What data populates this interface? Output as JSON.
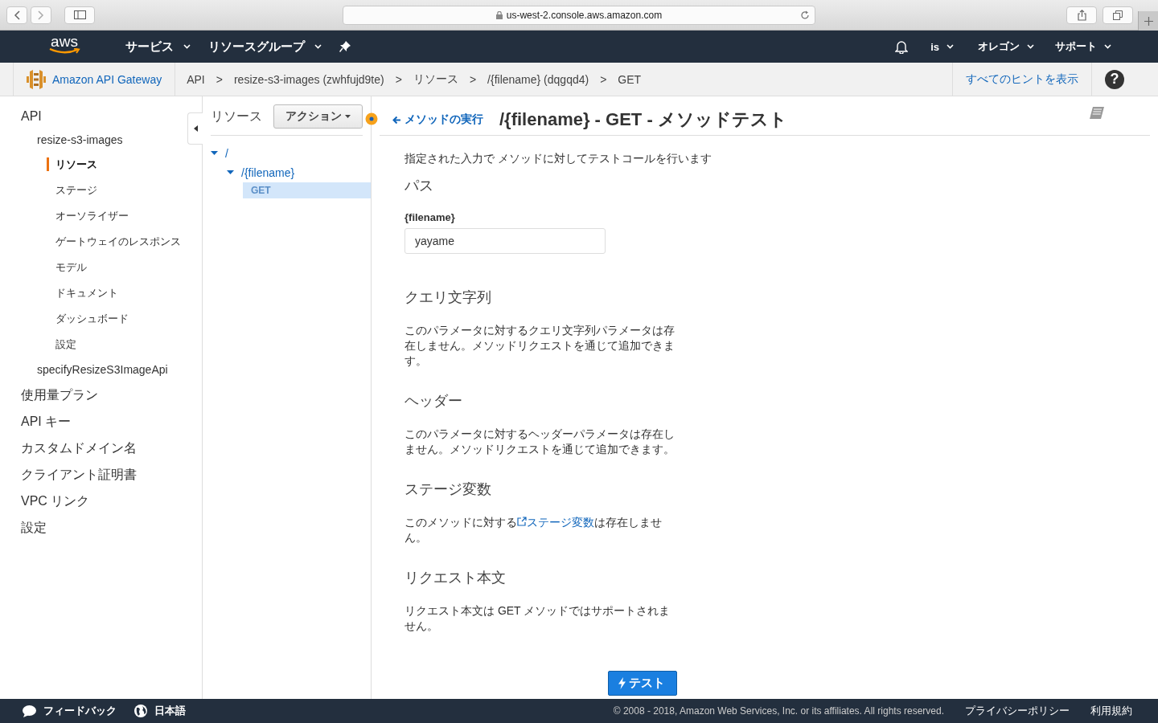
{
  "browser": {
    "url": "us-west-2.console.aws.amazon.com"
  },
  "top_nav": {
    "logo": "aws",
    "menus": [
      {
        "label": "サービス"
      },
      {
        "label": "リソースグループ"
      }
    ],
    "account": "is",
    "region": "オレゴン",
    "support": "サポート"
  },
  "breadcrumb": {
    "service": "Amazon API Gateway",
    "separator": ">",
    "items": [
      "API",
      "resize-s3-images (zwhfujd9te)",
      "リソース",
      "/{filename} (dqgqd4)",
      "GET"
    ],
    "hints_link": "すべてのヒントを表示",
    "help": "?"
  },
  "sidebar": {
    "items": [
      {
        "label": "API",
        "selected": false,
        "children": [
          {
            "label": "resize-s3-images",
            "selected": false,
            "children": [
              {
                "label": "リソース",
                "selected": true
              },
              {
                "label": "ステージ",
                "selected": false
              },
              {
                "label": "オーソライザー",
                "selected": false
              },
              {
                "label": "ゲートウェイのレスポンス",
                "selected": false
              },
              {
                "label": "モデル",
                "selected": false
              },
              {
                "label": "ドキュメント",
                "selected": false
              },
              {
                "label": "ダッシュボード",
                "selected": false
              },
              {
                "label": "設定",
                "selected": false
              }
            ]
          },
          {
            "label": "specifyResizeS3ImageApi",
            "selected": false
          }
        ]
      },
      {
        "label": "使用量プラン",
        "selected": false
      },
      {
        "label": "API キー",
        "selected": false
      },
      {
        "label": "カスタムドメイン名",
        "selected": false
      },
      {
        "label": "クライアント証明書",
        "selected": false
      },
      {
        "label": "VPC リンク",
        "selected": false
      },
      {
        "label": "設定",
        "selected": false
      }
    ]
  },
  "resources": {
    "title": "リソース",
    "actions_button": "アクション",
    "tree": [
      {
        "label": "/",
        "expanded": true,
        "selected": false,
        "children": [
          {
            "label": "/{filename}",
            "expanded": true,
            "selected": false,
            "children": [
              {
                "label": "GET",
                "selected": true
              }
            ]
          }
        ]
      }
    ]
  },
  "test": {
    "back_link": "メソッドの実行",
    "title": "/{filename} - GET - メソッドテスト",
    "description": "指定された入力で メソッドに対してテストコールを行います",
    "sections": [
      {
        "kind": "fields",
        "heading": "パス",
        "fields": [
          {
            "label": "{filename}",
            "value": "yayame"
          }
        ]
      },
      {
        "kind": "text",
        "heading": "クエリ文字列",
        "body": "このパラメータに対するクエリ文字列パラメータは存在しません。メソッドリクエストを通じて追加できます。"
      },
      {
        "kind": "text",
        "heading": "ヘッダー",
        "body": "このパラメータに対するヘッダーパラメータは存在しません。メソッドリクエストを通じて追加できます。"
      },
      {
        "kind": "link_text",
        "heading": "ステージ変数",
        "before": "このメソッドに対する",
        "link": "ステージ変数",
        "after": "は存在しません。"
      },
      {
        "kind": "text",
        "heading": "リクエスト本文",
        "body": "リクエスト本文は GET メソッドではサポートされません。"
      }
    ],
    "test_button": "テスト"
  },
  "footer": {
    "feedback": "フィードバック",
    "language": "日本語",
    "copyright": "© 2008 - 2018, Amazon Web Services, Inc. or its affiliates. All rights reserved.",
    "privacy": "プライバシーポリシー",
    "terms": "利用規約"
  }
}
